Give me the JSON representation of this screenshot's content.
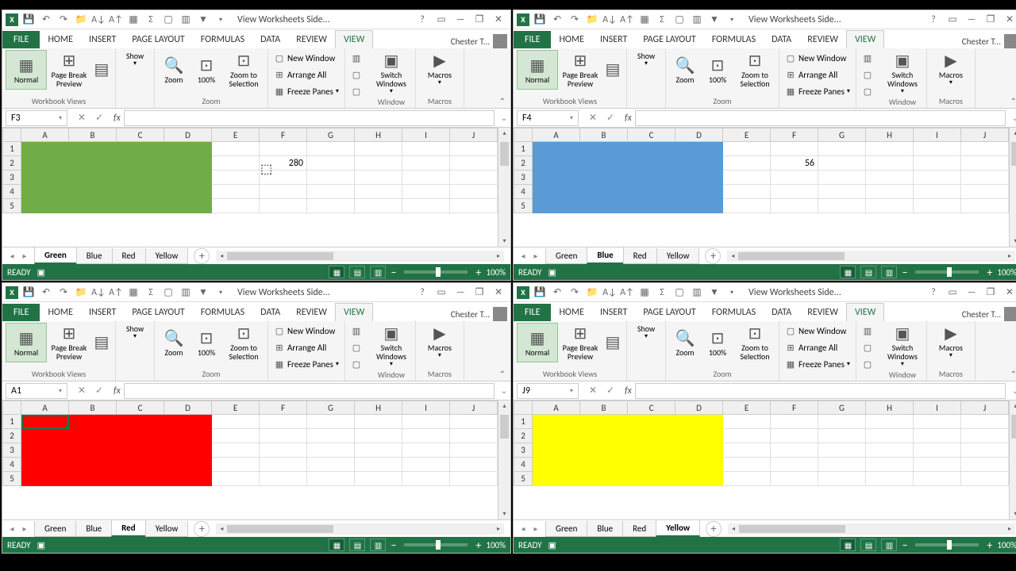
{
  "app": {
    "title": "View Worksheets Side...",
    "user": "Chester T...",
    "tabs": [
      "FILE",
      "HOME",
      "INSERT",
      "PAGE LAYOUT",
      "FORMULAS",
      "DATA",
      "REVIEW",
      "VIEW"
    ],
    "active_tab": "VIEW"
  },
  "ribbon": {
    "groups": {
      "views": "Workbook Views",
      "zoom": "Zoom",
      "window": "Window",
      "macros": "Macros"
    },
    "normal": "Normal",
    "pagebreak": "Page Break Preview",
    "show": "Show",
    "zoom": "Zoom",
    "z100": "100%",
    "zoomsel": "Zoom to Selection",
    "newwin": "New Window",
    "arrange": "Arrange All",
    "freeze": "Freeze Panes",
    "switch": "Switch Windows",
    "macros_btn": "Macros"
  },
  "status": {
    "ready": "READY",
    "zoom": "100%"
  },
  "sheets": [
    "Green",
    "Blue",
    "Red",
    "Yellow"
  ],
  "cols": [
    "A",
    "B",
    "C",
    "D",
    "E",
    "F",
    "G",
    "H",
    "I",
    "J"
  ],
  "rows": [
    "1",
    "2",
    "3",
    "4",
    "5"
  ],
  "windows": [
    {
      "name_box": "F3",
      "active_sheet": "Green",
      "fill_color": "#70ad47",
      "fill_range": "A1:D5",
      "cell_value": {
        "ref": "F2",
        "value": "280"
      },
      "selection": null,
      "active_window": true
    },
    {
      "name_box": "F4",
      "active_sheet": "Blue",
      "fill_color": "#5b9bd5",
      "fill_range": "A1:D5",
      "cell_value": {
        "ref": "F2",
        "value": "56"
      },
      "selection": null,
      "active_window": false
    },
    {
      "name_box": "A1",
      "active_sheet": "Red",
      "fill_color": "#ff0000",
      "fill_range": "A1:D5",
      "cell_value": null,
      "selection": "A1",
      "active_window": true
    },
    {
      "name_box": "J9",
      "active_sheet": "Yellow",
      "fill_color": "#ffff00",
      "fill_range": "A1:D5",
      "cell_value": null,
      "selection": null,
      "active_window": false
    }
  ],
  "chart_data": null
}
